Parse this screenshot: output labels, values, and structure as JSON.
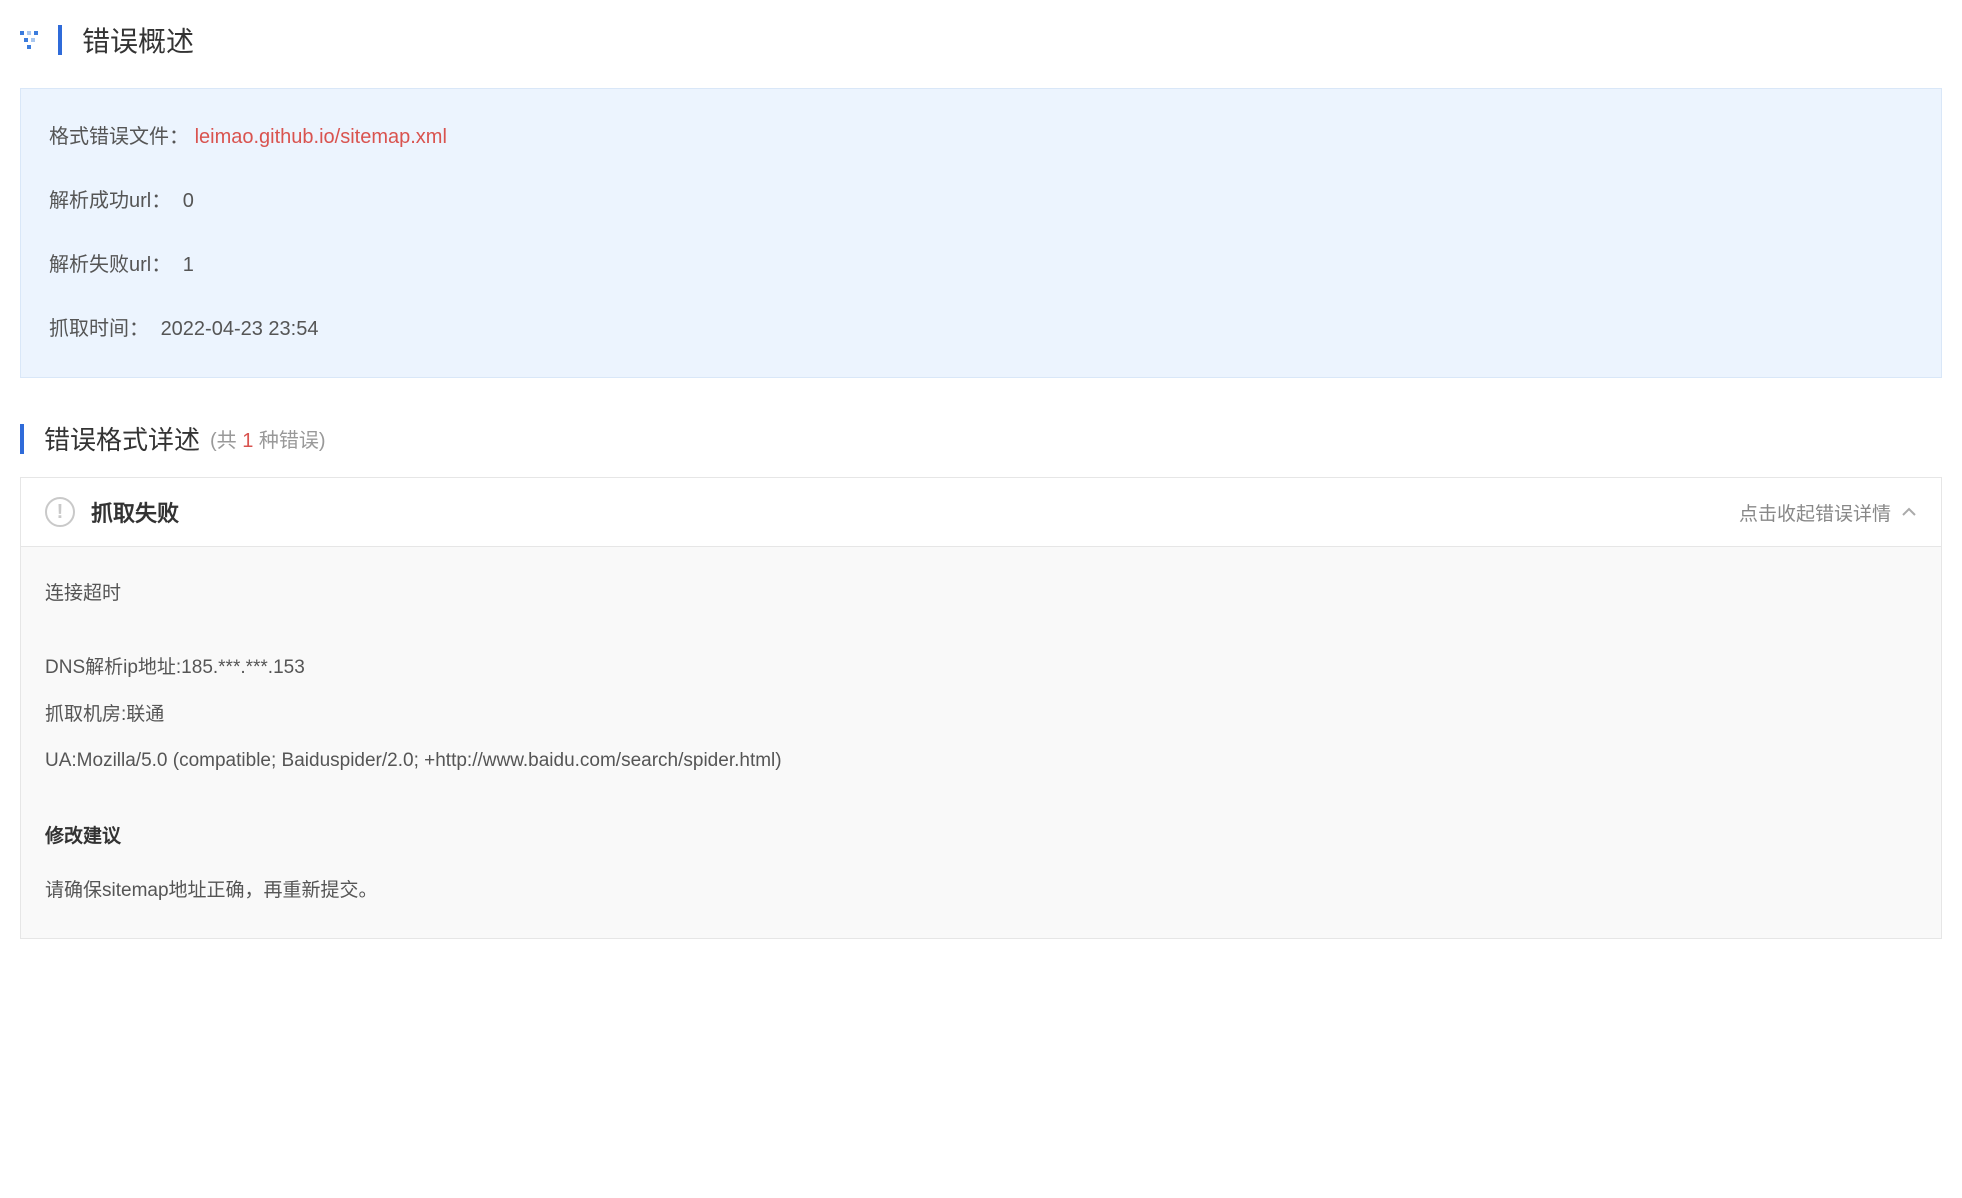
{
  "overview": {
    "title": "错误概述",
    "rows": {
      "file_label": "格式错误文件：",
      "file_value": "leimao.github.io/sitemap.xml",
      "success_label": "解析成功url：",
      "success_value": "0",
      "fail_label": "解析失败url：",
      "fail_value": "1",
      "time_label": "抓取时间：",
      "time_value": "2022-04-23 23:54"
    }
  },
  "details": {
    "title": "错误格式详述",
    "subtitle_prefix": "(共 ",
    "subtitle_count": "1",
    "subtitle_suffix": " 种错误)",
    "card": {
      "title": "抓取失败",
      "toggle_text": "点击收起错误详情",
      "body": {
        "timeout": "连接超时",
        "dns": "DNS解析ip地址:185.***.***.153",
        "room": "抓取机房:联通",
        "ua": "UA:Mozilla/5.0 (compatible; Baiduspider/2.0; +http://www.baidu.com/search/spider.html)",
        "suggestion_title": "修改建议",
        "suggestion_text": "请确保sitemap地址正确，再重新提交。"
      }
    }
  }
}
